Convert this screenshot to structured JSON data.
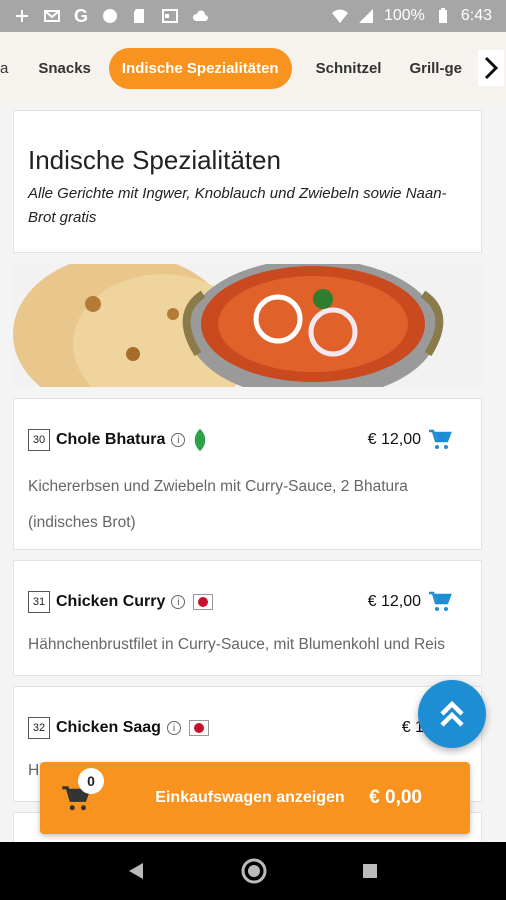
{
  "status_bar": {
    "battery": "100%",
    "time": "6:43"
  },
  "tabs": [
    {
      "label": "a"
    },
    {
      "label": "Snacks"
    },
    {
      "label": "Indische Spezialitäten",
      "active": true
    },
    {
      "label": "Schnitzel"
    },
    {
      "label": "Grill-ge"
    }
  ],
  "category": {
    "title": "Indische Spezialitäten",
    "description": "Alle Gerichte mit Ingwer, Knoblauch und Zwiebeln sowie Naan-Brot gratis"
  },
  "items": [
    {
      "number": "30",
      "name": "Chole Bhatura",
      "price": "€ 12,00",
      "badge": "veg-leaf-icon",
      "desc1": "Kichererbsen und Zwiebeln mit Curry-Sauce, 2 Bhatura",
      "desc2": "(indisches Brot)"
    },
    {
      "number": "31",
      "name": "Chicken Curry",
      "price": "€ 12,00",
      "badge": "chili-icon",
      "desc1": "Hähnchenbrustfilet in Curry-Sauce, mit Blumenkohl und Reis"
    },
    {
      "number": "32",
      "name": "Chicken Saag",
      "price": "€ 11,5",
      "badge": "chili-icon",
      "desc1": "H"
    }
  ],
  "cart": {
    "count": "0",
    "label": "Einkaufswagen anzeigen",
    "total": "€ 0,00"
  },
  "colors": {
    "accent": "#f7931e",
    "fab": "#1e8ed4",
    "cart_icon": "#1e8ed4"
  }
}
